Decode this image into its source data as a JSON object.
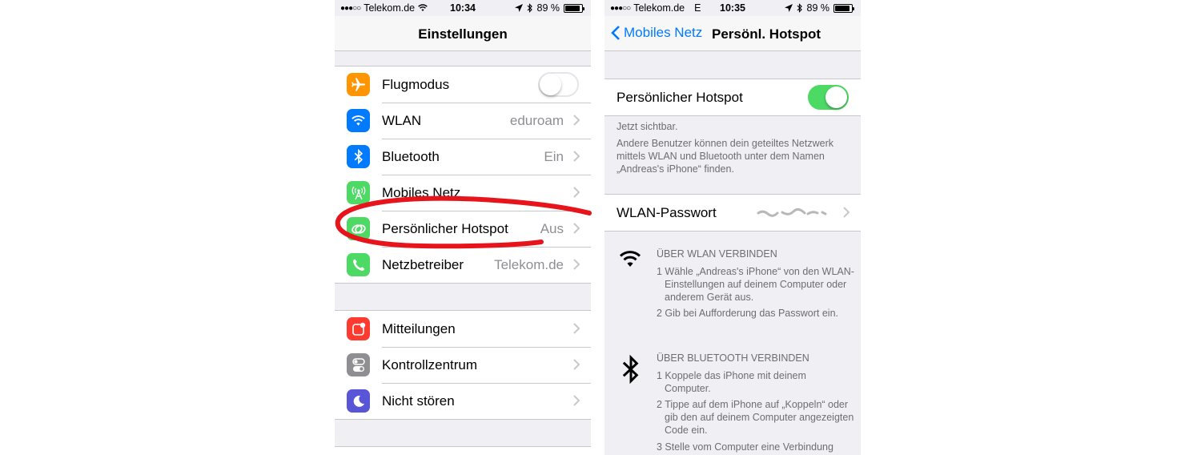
{
  "left": {
    "status": {
      "carrier": "Telekom.de",
      "time": "10:34",
      "battery": "89 %",
      "signal_dots": "●●●○○"
    },
    "title": "Einstellungen",
    "group1": [
      {
        "label": "Flugmodus",
        "value": "",
        "icon": "airplane-icon",
        "color": "#ff9500",
        "toggle": "off"
      },
      {
        "label": "WLAN",
        "value": "eduroam",
        "icon": "wifi-icon",
        "color": "#007aff"
      },
      {
        "label": "Bluetooth",
        "value": "Ein",
        "icon": "bluetooth-icon",
        "color": "#007aff"
      },
      {
        "label": "Mobiles Netz",
        "value": "",
        "icon": "antenna-icon",
        "color": "#4cd964"
      },
      {
        "label": "Persönlicher Hotspot",
        "value": "Aus",
        "icon": "hotspot-icon",
        "color": "#4cd964"
      },
      {
        "label": "Netzbetreiber",
        "value": "Telekom.de",
        "icon": "phone-icon",
        "color": "#4cd964"
      }
    ],
    "group2": [
      {
        "label": "Mitteilungen",
        "icon": "notifications-icon",
        "color": "#ff3b30"
      },
      {
        "label": "Kontrollzentrum",
        "icon": "control-center-icon",
        "color": "#8e8e93"
      },
      {
        "label": "Nicht stören",
        "icon": "moon-icon",
        "color": "#5856d6"
      }
    ]
  },
  "right": {
    "status": {
      "carrier": "Telekom.de",
      "network": "E",
      "time": "10:35",
      "battery": "89 %",
      "signal_dots": "●●●○○"
    },
    "back_label": "Mobiles Netz",
    "title": "Persönl. Hotspot",
    "hotspot_label": "Persönlicher Hotspot",
    "hotspot_toggle": "on",
    "visible_text": "Jetzt sichtbar.",
    "description": "Andere Benutzer können dein geteiltes Netzwerk mittels WLAN und Bluetooth unter dem Namen „Andreas's iPhone“ finden.",
    "password_label": "WLAN-Passwort",
    "wlan_section": {
      "heading": "ÜBER WLAN VERBINDEN",
      "steps": [
        "1 Wähle „Andreas's iPhone“ von den WLAN-Einstellungen auf deinem Computer oder anderem Gerät aus.",
        "2 Gib bei Aufforderung das Passwort ein."
      ]
    },
    "bluetooth_section": {
      "heading": "ÜBER BLUETOOTH VERBINDEN",
      "steps": [
        "1 Koppele das iPhone mit deinem Computer.",
        "2 Tippe auf dem iPhone auf „Koppeln“ oder gib den auf deinem Computer angezeigten Code ein.",
        "3 Stelle vom Computer eine Verbindung"
      ]
    }
  },
  "colors": {
    "accent": "#007aff",
    "toggle_on": "#4cd964",
    "annotation": "#e8141b"
  }
}
